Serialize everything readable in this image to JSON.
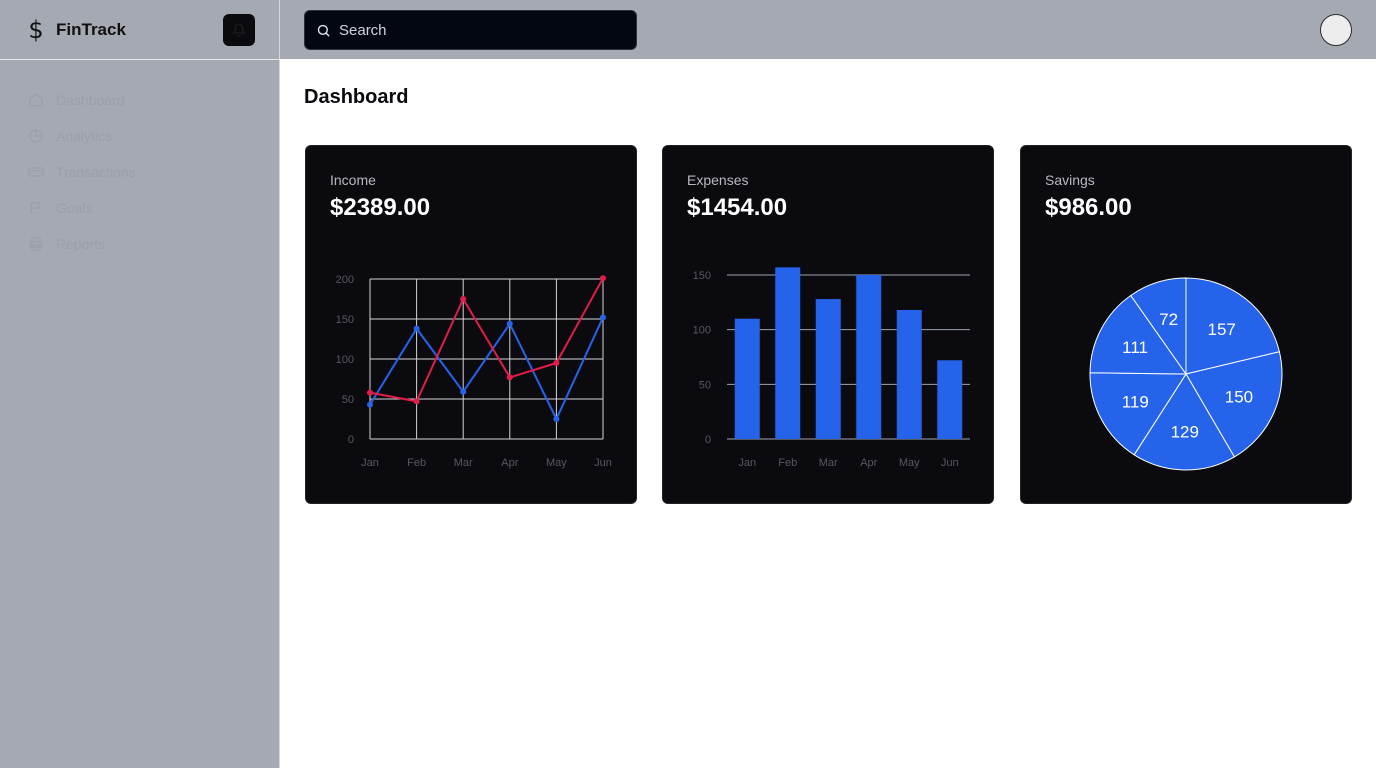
{
  "app": {
    "name": "FinTrack",
    "brand_icon": "dollar-icon"
  },
  "sidebar": {
    "items": [
      {
        "label": "Dashboard",
        "icon": "home-icon"
      },
      {
        "label": "Analytics",
        "icon": "pie-chart-icon"
      },
      {
        "label": "Transactions",
        "icon": "credit-card-icon"
      },
      {
        "label": "Goals",
        "icon": "flag-icon"
      },
      {
        "label": "Reports",
        "icon": "printer-icon"
      }
    ]
  },
  "header": {
    "search_placeholder": "Search",
    "bell_icon": "bell-icon",
    "avatar": "user-avatar"
  },
  "main": {
    "title": "Dashboard",
    "cards": [
      {
        "label": "Income",
        "value": "$2389.00"
      },
      {
        "label": "Expenses",
        "value": "$1454.00"
      },
      {
        "label": "Savings",
        "value": "$986.00"
      }
    ]
  },
  "colors": {
    "blue": "#2563eb",
    "red": "#e11d48",
    "card_bg": "#0b0b0f",
    "chrome": "#a5a9b1"
  },
  "chart_data": [
    {
      "type": "line",
      "categories": [
        "Jan",
        "Feb",
        "Mar",
        "Apr",
        "May",
        "Jun"
      ],
      "series": [
        {
          "values": [
            43,
            138,
            59,
            144,
            25,
            152
          ],
          "color": "#2563eb"
        },
        {
          "values": [
            58,
            47,
            175,
            77,
            95,
            201
          ],
          "color": "#e11d48"
        }
      ],
      "yticks": [
        "0",
        "50",
        "100",
        "150",
        "200"
      ],
      "ylim": [
        0,
        200
      ],
      "grid": true
    },
    {
      "type": "bar",
      "categories": [
        "Jan",
        "Feb",
        "Mar",
        "Apr",
        "May",
        "Jun"
      ],
      "values": [
        110,
        157,
        128,
        150,
        118,
        72
      ],
      "yticks": [
        "0",
        "50",
        "100",
        "150"
      ],
      "ylim": [
        0,
        150
      ],
      "grid": true,
      "color": "#2563eb"
    },
    {
      "type": "pie",
      "values": [
        157,
        150,
        129,
        119,
        111,
        72
      ],
      "labels": [
        "157",
        "150",
        "129",
        "119",
        "111",
        "72"
      ],
      "color": "#2563eb"
    }
  ]
}
